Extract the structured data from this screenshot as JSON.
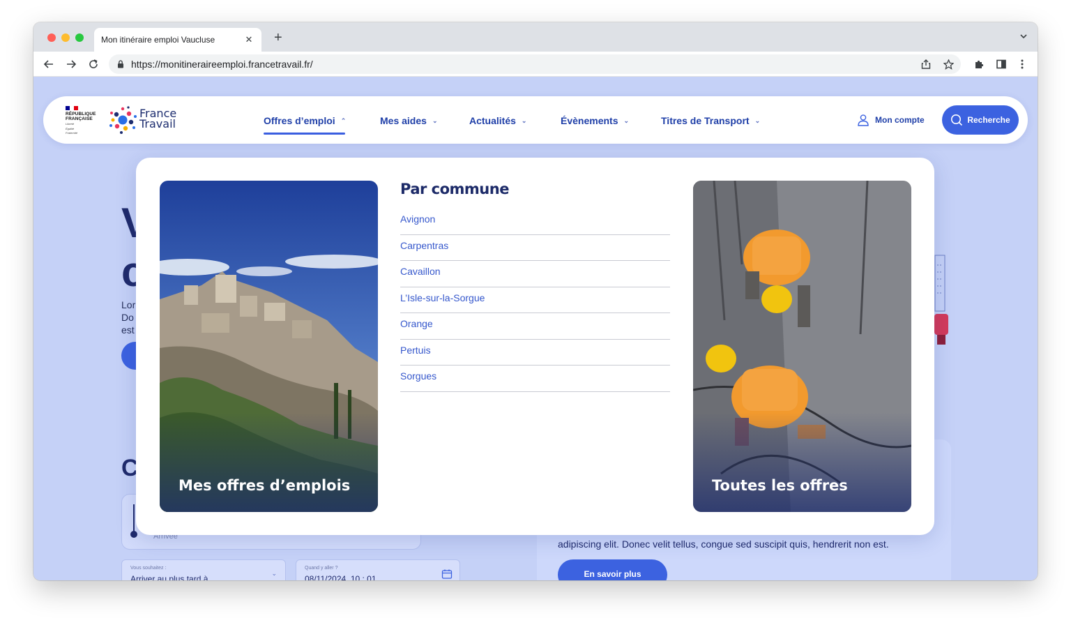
{
  "browser": {
    "tab_title": "Mon itinéraire emploi Vaucluse",
    "url": "https://monitineraireemploi.francetravail.fr/"
  },
  "header": {
    "rf_lines": [
      "RÉPUBLIQUE",
      "FRANÇAISE"
    ],
    "rf_motto": [
      "Liberté",
      "Égalité",
      "Fraternité"
    ],
    "brand_line1": "France",
    "brand_line2": "Travail",
    "nav": [
      {
        "label": "Offres d’emploi",
        "active": true
      },
      {
        "label": "Mes aides"
      },
      {
        "label": "Actualités"
      },
      {
        "label": "Évènements"
      },
      {
        "label": "Titres de Transport"
      }
    ],
    "account_label": "Mon compte",
    "search_label": "Recherche"
  },
  "mega_menu": {
    "left_card_label": "Mes offres d’emplois",
    "heading": "Par commune",
    "links": [
      "Avignon",
      "Carpentras",
      "Cavaillon",
      "L’Isle-sur-la-Sorgue",
      "Orange",
      "Pertuis",
      "Sorgues"
    ],
    "right_card_label": "Toutes les offres"
  },
  "background_page": {
    "hero_letter1": "V",
    "hero_letter2": "c",
    "intro_fragments": [
      "Lor",
      "Do",
      "est"
    ],
    "section_letter": "C",
    "arrival_placeholder": "Arrivée",
    "wish_label": "Vous souhaitez :",
    "wish_value": "Arriver au plus tard à",
    "when_label": "Quand y aller ?",
    "when_value": "08/11/2024, 10 : 01",
    "card_text": "adipiscing elit. Donec velit  tellus, congue sed suscipit quis, hendrerit non est.",
    "card_button": "En savoir plus"
  },
  "colors": {
    "brand_blue": "#3c62e0",
    "nav_text": "#1f3fa8",
    "page_bg": "#c5d1f7",
    "link": "#3557cc"
  }
}
